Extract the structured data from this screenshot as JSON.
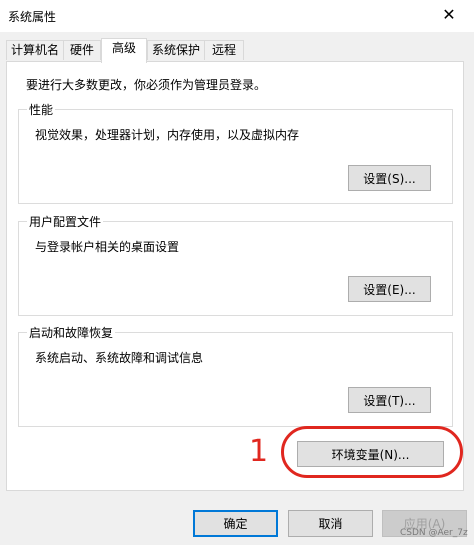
{
  "window": {
    "title": "系统属性",
    "close_glyph": "✕"
  },
  "tabs": [
    {
      "label": "计算机名",
      "active": false
    },
    {
      "label": "硬件",
      "active": false
    },
    {
      "label": "高级",
      "active": true
    },
    {
      "label": "系统保护",
      "active": false
    },
    {
      "label": "远程",
      "active": false
    }
  ],
  "notice": "要进行大多数更改，你必须作为管理员登录。",
  "groups": {
    "performance": {
      "title": "性能",
      "description": "视觉效果，处理器计划，内存使用，以及虚拟内存",
      "button": "设置(S)..."
    },
    "user_profiles": {
      "title": "用户配置文件",
      "description": "与登录帐户相关的桌面设置",
      "button": "设置(E)..."
    },
    "startup_recovery": {
      "title": "启动和故障恢复",
      "description": "系统启动、系统故障和调试信息",
      "button": "设置(T)..."
    }
  },
  "env_button": "环境变量(N)...",
  "footer": {
    "ok": "确定",
    "cancel": "取消",
    "apply": "应用(A)"
  },
  "annotation": {
    "number": "1",
    "color": "#e0271f"
  },
  "watermark": "CSDN @Aer_7z",
  "colors": {
    "focus_border": "#0078d7",
    "panel_bg": "#ffffff",
    "window_bg": "#f0f0f0"
  }
}
